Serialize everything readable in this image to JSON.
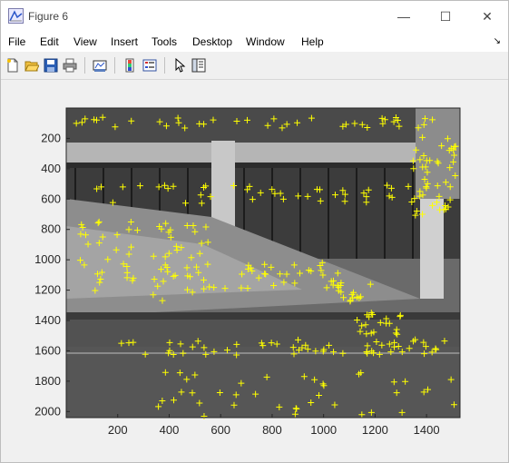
{
  "window": {
    "title": "Figure 6",
    "minimize_glyph": "—",
    "maximize_glyph": "☐",
    "close_glyph": "✕"
  },
  "menu": {
    "items": [
      "File",
      "Edit",
      "View",
      "Insert",
      "Tools",
      "Desktop",
      "Window",
      "Help"
    ],
    "overflow_glyph": "↘"
  },
  "toolbar": {
    "icons": [
      "new-figure-icon",
      "open-file-icon",
      "save-icon",
      "print-icon",
      "link-plot-icon",
      "insert-colorbar-icon",
      "insert-legend-icon",
      "edit-plot-icon",
      "property-inspector-icon"
    ]
  },
  "figure": {
    "background": "grayscale photograph of a building facade with overlaid detected feature points",
    "marker_color": "#ffff00",
    "marker_symbol": "+",
    "x_ticks": [
      "200",
      "400",
      "600",
      "800",
      "1000",
      "1200",
      "1400"
    ],
    "y_ticks": [
      "200",
      "400",
      "600",
      "800",
      "1000",
      "1200",
      "1400",
      "1600",
      "1800",
      "2000"
    ]
  }
}
